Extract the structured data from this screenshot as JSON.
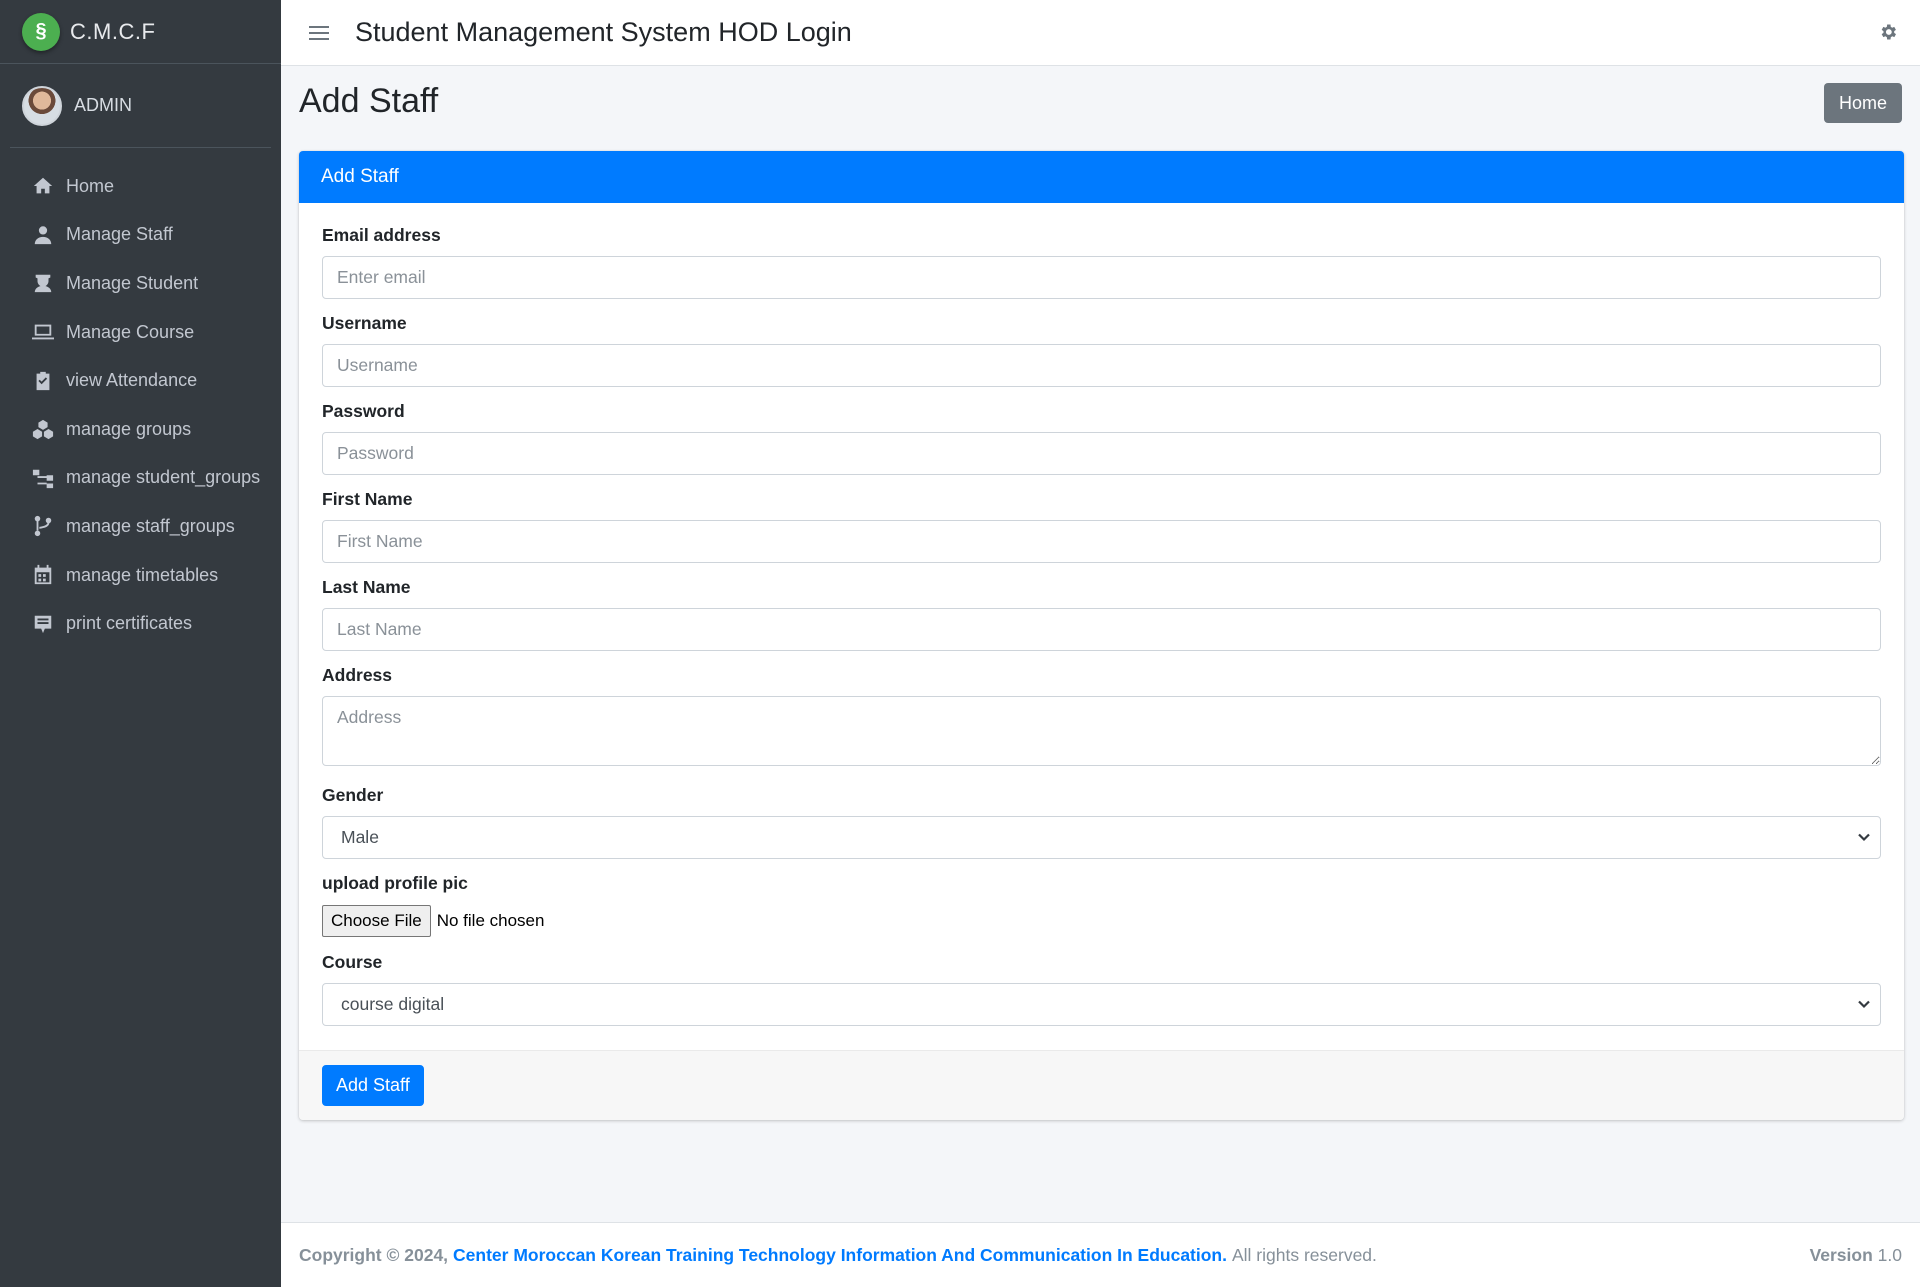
{
  "brand": {
    "name": "C.M.C.F",
    "logo_icon": "cmcf-logo"
  },
  "user": {
    "name": "ADMIN"
  },
  "sidebar": {
    "items": [
      {
        "label": "Home",
        "icon": "home-icon"
      },
      {
        "label": "Manage Staff",
        "icon": "user-icon"
      },
      {
        "label": "Manage Student",
        "icon": "student-icon"
      },
      {
        "label": "Manage Course",
        "icon": "laptop-icon"
      },
      {
        "label": "view Attendance",
        "icon": "clipboard-check-icon"
      },
      {
        "label": "manage groups",
        "icon": "cubes-icon"
      },
      {
        "label": "manage student_groups",
        "icon": "sitemap-icon"
      },
      {
        "label": "manage staff_groups",
        "icon": "code-branch-icon"
      },
      {
        "label": "manage timetables",
        "icon": "calendar-icon"
      },
      {
        "label": "print certificates",
        "icon": "certificate-icon"
      }
    ]
  },
  "header": {
    "title": "Student Management System HOD Login"
  },
  "page": {
    "title": "Add Staff",
    "home_button": "Home"
  },
  "card": {
    "title": "Add Staff",
    "fields": {
      "email": {
        "label": "Email address",
        "placeholder": "Enter email",
        "value": ""
      },
      "username": {
        "label": "Username",
        "placeholder": "Username",
        "value": ""
      },
      "password": {
        "label": "Password",
        "placeholder": "Password",
        "value": ""
      },
      "first_name": {
        "label": "First Name",
        "placeholder": "First Name",
        "value": ""
      },
      "last_name": {
        "label": "Last Name",
        "placeholder": "Last Name",
        "value": ""
      },
      "address": {
        "label": "Address",
        "placeholder": "Address",
        "value": ""
      },
      "gender": {
        "label": "Gender",
        "selected": "Male"
      },
      "profile_pic": {
        "label": "upload profile pic",
        "button": "Choose File",
        "status": "No file chosen"
      },
      "course": {
        "label": "Course",
        "selected": "course digital"
      }
    },
    "submit": "Add Staff"
  },
  "footer": {
    "copyright": "Copyright © 2024,",
    "org": "Center Moroccan Korean Training Technology Information And Communication In Education.",
    "rights": "All rights reserved.",
    "version_label": "Version",
    "version_value": "1.0"
  },
  "colors": {
    "primary": "#007bff",
    "sidebar": "#343a40",
    "secondary": "#6c757d",
    "brand_logo": "#4caf50"
  }
}
